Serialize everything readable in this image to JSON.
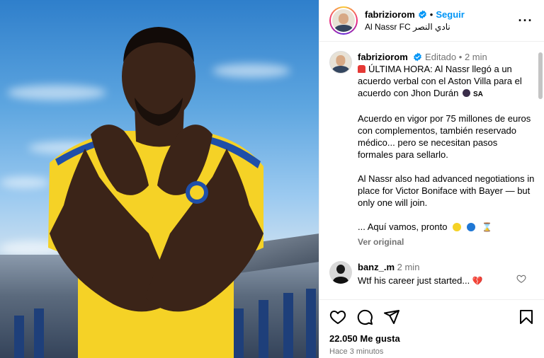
{
  "header": {
    "username": "fabriziorom",
    "separator": "•",
    "follow_label": "Seguir",
    "location": "Al Nassr FC نادي النصر",
    "more_label": "···"
  },
  "caption": {
    "username": "fabriziorom",
    "edited_label": "Editado",
    "separator": "•",
    "time": "2 min",
    "paragraphs": [
      "ÚLTIMA HORA: Al Nassr llegó a un acuerdo verbal con el Aston Villa para el acuerdo con Jhon Durán",
      "Acuerdo en vigor por 75 millones de euros con complementos, también reservado médico... pero se necesitan pasos formales para sellarlo.",
      "Al Nassr also had advanced negotiations in place for Victor Boniface with Bayer — but only one will join.",
      "... Aquí vamos, pronto"
    ],
    "flag_text": "SA",
    "see_original_label": "Ver original"
  },
  "comment": {
    "username": "banz_.m",
    "time": "2 min",
    "text": "Wtf his career just started...",
    "emoji": "💔"
  },
  "footer": {
    "likes": "22.050 Me gusta",
    "time_ago": "Hace 3 minutos"
  },
  "icons": {
    "verified": "verified-badge-icon",
    "like": "heart-icon",
    "comment": "comment-icon",
    "share": "paper-plane-icon",
    "save": "bookmark-icon"
  },
  "colors": {
    "accent": "#0095f6",
    "jersey_yellow": "#f5d226",
    "jersey_blue": "#1f4fa8",
    "secondary_text": "#737373"
  }
}
